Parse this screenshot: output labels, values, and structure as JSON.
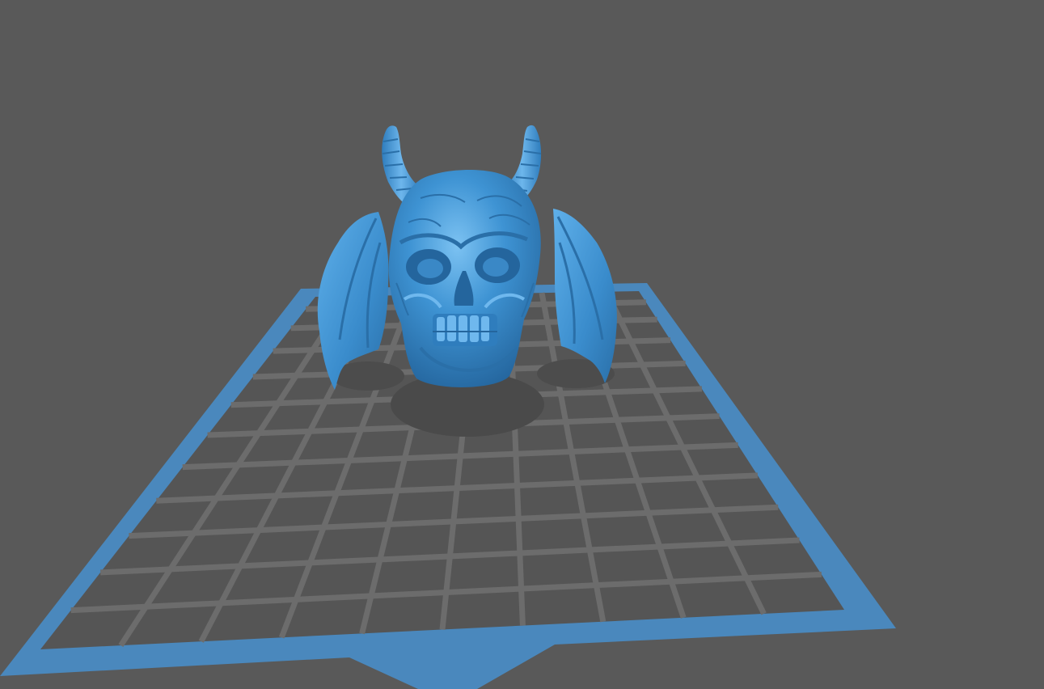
{
  "viewport": {
    "background": "#595959",
    "view": "perspective-front"
  },
  "build_plate": {
    "border_color": "#4a88bd",
    "grid_line_color": "#6c6c6c",
    "fill_color": "#555555",
    "columns": 10,
    "rows": 12
  },
  "model": {
    "name_icon": "demon-skull-with-horns-and-bat-wings",
    "color": "#3e93d3",
    "shade_color": "#2a6fa8",
    "highlight_color": "#6fb8ee"
  },
  "shadow": {
    "color": "#4a4a4a"
  }
}
